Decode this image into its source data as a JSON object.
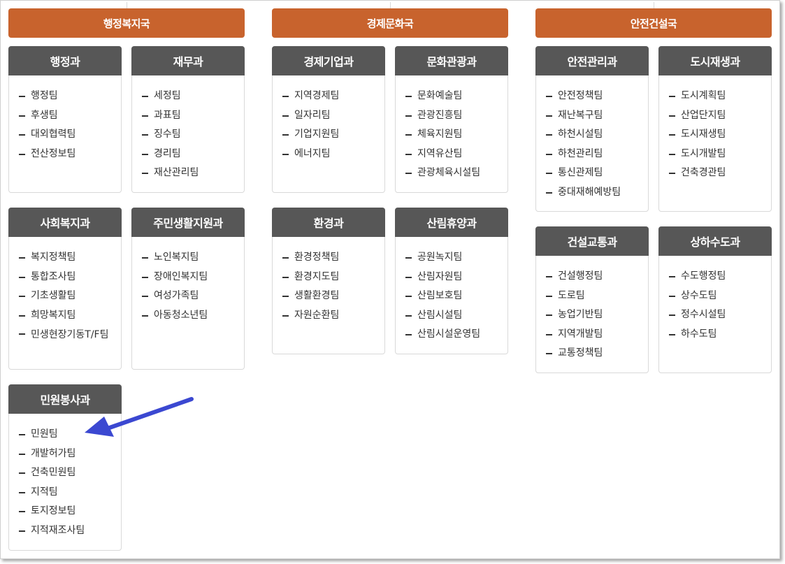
{
  "bureaus": [
    {
      "name": "행정복지국",
      "departments": [
        {
          "name": "행정과",
          "teams": [
            "행정팀",
            "후생팀",
            "대외협력팀",
            "전산정보팀"
          ]
        },
        {
          "name": "재무과",
          "teams": [
            "세정팀",
            "과표팀",
            "징수팀",
            "경리팀",
            "재산관리팀"
          ]
        },
        {
          "name": "사회복지과",
          "teams": [
            "복지정책팀",
            "통합조사팀",
            "기초생활팀",
            "희망복지팀",
            "민생현장기동T/F팀"
          ]
        },
        {
          "name": "주민생활지원과",
          "teams": [
            "노인복지팀",
            "장애인복지팀",
            "여성가족팀",
            "아동청소년팀"
          ]
        },
        {
          "name": "민원봉사과",
          "teams": [
            "민원팀",
            "개발허가팀",
            "건축민원팀",
            "지적팀",
            "토지정보팀",
            "지적재조사팀"
          ]
        }
      ]
    },
    {
      "name": "경제문화국",
      "departments": [
        {
          "name": "경제기업과",
          "teams": [
            "지역경제팀",
            "일자리팀",
            "기업지원팀",
            "에너지팀"
          ]
        },
        {
          "name": "문화관광과",
          "teams": [
            "문화예술팀",
            "관광진흥팀",
            "체육지원팀",
            "지역유산팀",
            "관광체육시설팀"
          ]
        },
        {
          "name": "환경과",
          "teams": [
            "환경정책팀",
            "환경지도팀",
            "생활환경팀",
            "자원순환팀"
          ]
        },
        {
          "name": "산림휴양과",
          "teams": [
            "공원녹지팀",
            "산림자원팀",
            "산림보호팀",
            "산림시설팀",
            "산림시설운영팀"
          ]
        }
      ]
    },
    {
      "name": "안전건설국",
      "departments": [
        {
          "name": "안전관리과",
          "teams": [
            "안전정책팀",
            "재난복구팀",
            "하천시설팀",
            "하천관리팀",
            "통신관제팀",
            "중대재해예방팀"
          ]
        },
        {
          "name": "도시재생과",
          "teams": [
            "도시계획팀",
            "산업단지팀",
            "도시재생팀",
            "도시개발팀",
            "건축경관팀"
          ]
        },
        {
          "name": "건설교통과",
          "teams": [
            "건설행정팀",
            "도로팀",
            "농업기반팀",
            "지역개발팀",
            "교통정책팀"
          ]
        },
        {
          "name": "상하수도과",
          "teams": [
            "수도행정팀",
            "상수도팀",
            "정수시설팀",
            "하수도팀"
          ]
        }
      ]
    }
  ],
  "annotation": {
    "icon": "arrow-icon",
    "color": "#3b48d1"
  },
  "colors": {
    "bureau": "#c8632d",
    "department": "#575757"
  }
}
